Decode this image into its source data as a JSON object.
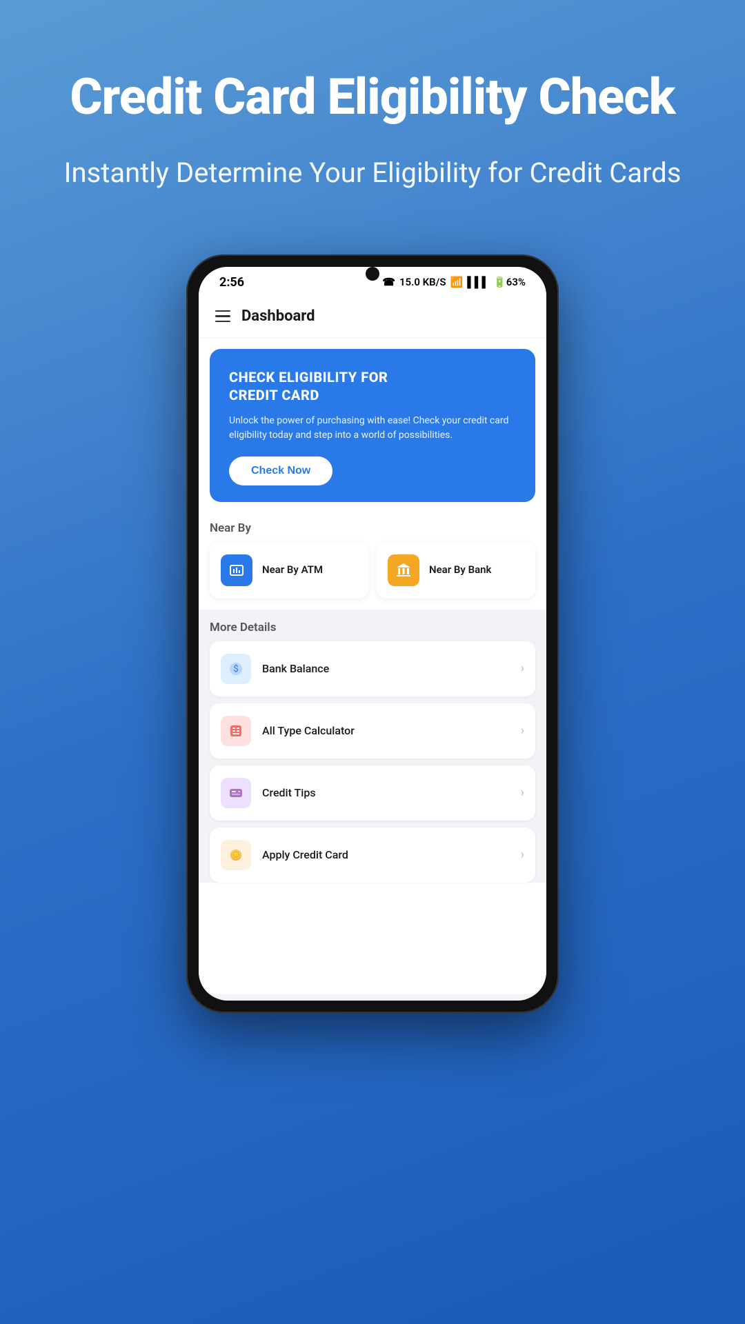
{
  "hero": {
    "title": "Credit Card Eligibility Check",
    "subtitle": "Instantly Determine Your Eligibility for Credit Cards"
  },
  "status_bar": {
    "time": "2:56",
    "icons": "☎ 15.0 KB/S ⊕ ✆ ▌▌▌ 63%"
  },
  "header": {
    "title": "Dashboard"
  },
  "eligibility_card": {
    "title": "CHECK ELIGIBILITY FOR\nCREDIT CARD",
    "description": "Unlock the power of purchasing with ease! Check your credit card eligibility today and step into a world of possibilities.",
    "button_label": "Check Now"
  },
  "nearby": {
    "section_label": "Near By",
    "items": [
      {
        "label": "Near By ATM",
        "icon": "💳",
        "icon_class": "atm"
      },
      {
        "label": "Near By Bank",
        "icon": "🏛",
        "icon_class": "bank"
      }
    ]
  },
  "more_details": {
    "section_label": "More Details",
    "items": [
      {
        "label": "Bank Balance",
        "icon": "💰",
        "icon_class": "blue-light"
      },
      {
        "label": "All Type Calculator",
        "icon": "🧮",
        "icon_class": "pink-light"
      },
      {
        "label": "Credit Tips",
        "icon": "💳",
        "icon_class": "purple-light"
      },
      {
        "label": "Apply Credit Card",
        "icon": "🪙",
        "icon_class": "orange-light"
      }
    ]
  }
}
